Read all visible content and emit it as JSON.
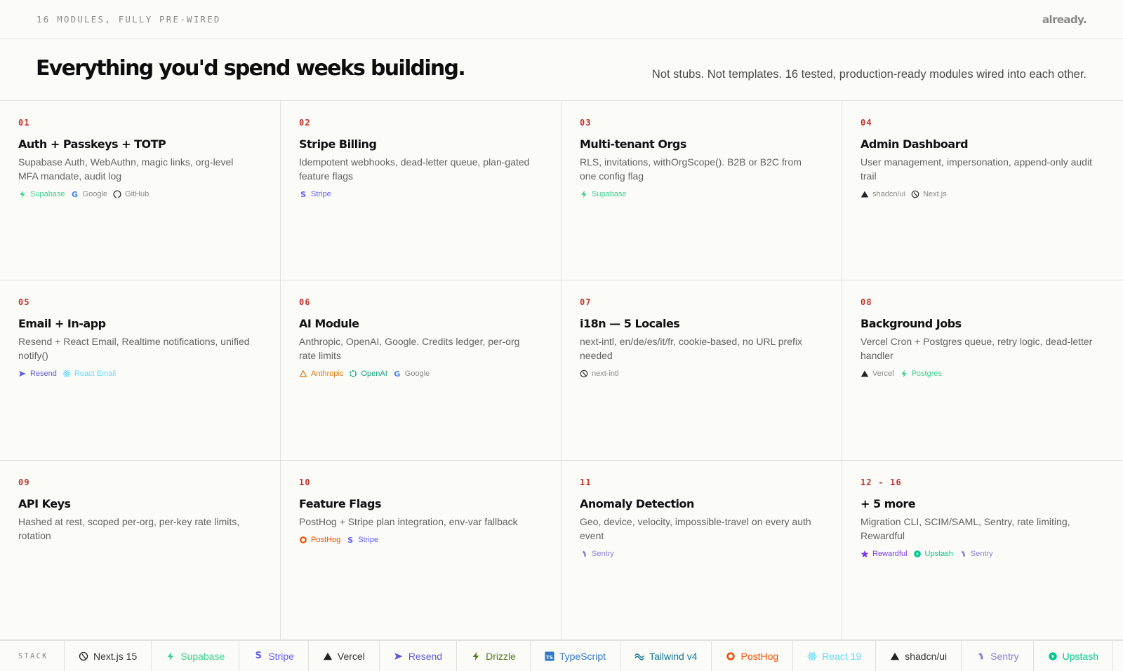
{
  "header": {
    "eyebrow": "16 MODULES, FULLY PRE-WIRED",
    "logo": "already."
  },
  "hero": {
    "title": "Everything you'd spend weeks building.",
    "subtitle": "Not stubs. Not templates. 16 tested, production-ready modules wired into each other."
  },
  "modules": [
    {
      "num": "01",
      "title": "Auth + Passkeys + TOTP",
      "desc": "Supabase Auth, WebAuthn, magic links, org-level MFA mandate, audit log",
      "tags": [
        {
          "label": "Supabase",
          "icon": "bolt-icon",
          "color": "#3ecf8e"
        },
        {
          "label": "Google",
          "icon": "google-icon",
          "color": "#8a8a85"
        },
        {
          "label": "GitHub",
          "icon": "github-icon",
          "color": "#8a8a85"
        }
      ]
    },
    {
      "num": "02",
      "title": "Stripe Billing",
      "desc": "Idempotent webhooks, dead-letter queue, plan-gated feature flags",
      "tags": [
        {
          "label": "Stripe",
          "icon": "stripe-icon",
          "color": "#635bff"
        }
      ]
    },
    {
      "num": "03",
      "title": "Multi-tenant Orgs",
      "desc": "RLS, invitations, withOrgScope(). B2B or B2C from one config flag",
      "tags": [
        {
          "label": "Supabase",
          "icon": "bolt-icon",
          "color": "#3ecf8e"
        }
      ]
    },
    {
      "num": "04",
      "title": "Admin Dashboard",
      "desc": "User management, impersonation, append-only audit trail",
      "tags": [
        {
          "label": "shadcn/ui",
          "icon": "triangle-icon",
          "color": "#8a8a85"
        },
        {
          "label": "Next.js",
          "icon": "nextjs-icon",
          "color": "#8a8a85"
        }
      ]
    },
    {
      "num": "05",
      "title": "Email + In-app",
      "desc": "Resend + React Email, Realtime notifications, unified notify()",
      "tags": [
        {
          "label": "Resend",
          "icon": "send-icon",
          "color": "#5b5bd6"
        },
        {
          "label": "React Email",
          "icon": "react-icon",
          "color": "#61dafb"
        }
      ]
    },
    {
      "num": "06",
      "title": "AI Module",
      "desc": "Anthropic, OpenAI, Google. Credits ledger, per-org rate limits",
      "tags": [
        {
          "label": "Anthropic",
          "icon": "anthropic-icon",
          "color": "#d97706"
        },
        {
          "label": "OpenAI",
          "icon": "openai-icon",
          "color": "#10a37f"
        },
        {
          "label": "Google",
          "icon": "google-icon",
          "color": "#8a8a85"
        }
      ]
    },
    {
      "num": "07",
      "title": "i18n — 5 Locales",
      "desc": "next-intl, en/de/es/it/fr, cookie-based, no URL prefix needed",
      "tags": [
        {
          "label": "next-intl",
          "icon": "nextjs-icon",
          "color": "#8a8a85"
        }
      ]
    },
    {
      "num": "08",
      "title": "Background Jobs",
      "desc": "Vercel Cron + Postgres queue, retry logic, dead-letter handler",
      "tags": [
        {
          "label": "Vercel",
          "icon": "triangle-icon",
          "color": "#8a8a85"
        },
        {
          "label": "Postgres",
          "icon": "bolt-icon",
          "color": "#3ecf8e"
        }
      ]
    },
    {
      "num": "09",
      "title": "API Keys",
      "desc": "Hashed at rest, scoped per-org, per-key rate limits, rotation",
      "tags": []
    },
    {
      "num": "10",
      "title": "Feature Flags",
      "desc": "PostHog + Stripe plan integration, env-var fallback",
      "tags": [
        {
          "label": "PostHog",
          "icon": "posthog-icon",
          "color": "#f54e00"
        },
        {
          "label": "Stripe",
          "icon": "stripe-icon",
          "color": "#635bff"
        }
      ]
    },
    {
      "num": "11",
      "title": "Anomaly Detection",
      "desc": "Geo, device, velocity, impossible-travel on every auth event",
      "tags": [
        {
          "label": "Sentry",
          "icon": "sentry-icon",
          "color": "#8b7dd8"
        }
      ]
    },
    {
      "num": "12 - 16",
      "title": "+ 5 more",
      "desc": "Migration CLI, SCIM/SAML, Sentry, rate limiting, Rewardful",
      "tags": [
        {
          "label": "Rewardful",
          "icon": "star-icon",
          "color": "#7c3aed"
        },
        {
          "label": "Upstash",
          "icon": "upstash-icon",
          "color": "#00c98d"
        },
        {
          "label": "Sentry",
          "icon": "sentry-icon",
          "color": "#8b7dd8"
        }
      ]
    }
  ],
  "stack": {
    "label": "STACK",
    "items": [
      {
        "label": "Next.js 15",
        "icon": "nextjs-icon",
        "color": "#333333"
      },
      {
        "label": "Supabase",
        "icon": "bolt-icon",
        "color": "#3ecf8e"
      },
      {
        "label": "Stripe",
        "icon": "stripe-icon",
        "color": "#635bff"
      },
      {
        "label": "Vercel",
        "icon": "triangle-icon",
        "color": "#333333"
      },
      {
        "label": "Resend",
        "icon": "send-icon",
        "color": "#5b5bd6"
      },
      {
        "label": "Drizzle",
        "icon": "drizzle-icon",
        "color": "#4a7c1f"
      },
      {
        "label": "TypeScript",
        "icon": "typescript-icon",
        "color": "#3178c6"
      },
      {
        "label": "Tailwind v4",
        "icon": "tailwind-icon",
        "color": "#0e7490"
      },
      {
        "label": "PostHog",
        "icon": "posthog-icon",
        "color": "#f54e00"
      },
      {
        "label": "React 19",
        "icon": "react-icon",
        "color": "#61dafb"
      },
      {
        "label": "shadcn/ui",
        "icon": "triangle-icon",
        "color": "#333333"
      },
      {
        "label": "Sentry",
        "icon": "sentry-icon",
        "color": "#8b7dd8"
      },
      {
        "label": "Upstash",
        "icon": "upstash-icon",
        "color": "#00c98d"
      }
    ],
    "tail_icon": "star-icon",
    "tail_color": "#7c3aed"
  }
}
